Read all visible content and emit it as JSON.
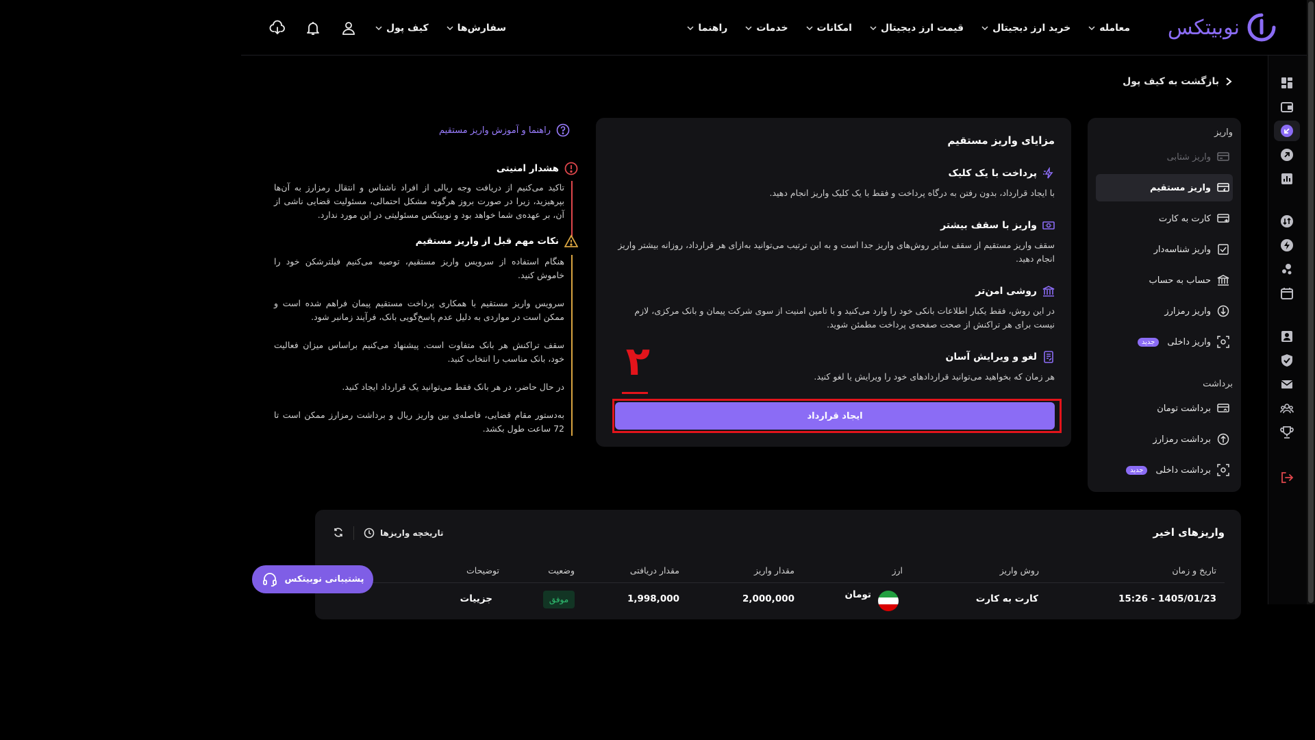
{
  "brand": {
    "name": "نوبیتکس",
    "color": "#8b6cf5"
  },
  "nav": {
    "items": [
      "معامله",
      "خرید ارز دیجیتال",
      "قیمت ارز دیجیتال",
      "امکانات",
      "خدمات",
      "راهنما"
    ],
    "wallet": "کیف پول",
    "orders": "سفارش‌ها",
    "icons": [
      "download-app-icon",
      "bell-icon",
      "user-icon"
    ]
  },
  "back": {
    "label": "بازگشت به کیف پول"
  },
  "sidemenu": {
    "deposit_section": "واریز",
    "deposit_items": [
      {
        "label": "واریز شتابی",
        "icon": "card-bank-icon",
        "disabled": true
      },
      {
        "label": "واریز مستقیم",
        "icon": "card-in-icon",
        "active": true
      },
      {
        "label": "کارت به کارت",
        "icon": "card-transfer-icon"
      },
      {
        "label": "واریز شناسه‌دار",
        "icon": "id-check-icon"
      },
      {
        "label": "حساب به حساب",
        "icon": "bank-icon"
      },
      {
        "label": "واریز رمزارز",
        "icon": "arrow-down-circle-icon"
      },
      {
        "label": "واریز داخلی",
        "icon": "scan-icon",
        "badge": "جدید"
      }
    ],
    "withdraw_section": "برداشت",
    "withdraw_items": [
      {
        "label": "برداشت تومان",
        "icon": "card-out-icon"
      },
      {
        "label": "برداشت رمزارز",
        "icon": "arrow-up-circle-icon"
      },
      {
        "label": "برداشت داخلی",
        "icon": "scan-icon",
        "badge": "جدید"
      }
    ]
  },
  "card": {
    "title": "مزایای واریز مستقیم",
    "features": [
      {
        "title": "پرداخت با یک کلیک",
        "desc": "با ایجاد قرارداد، بدون رفتن به درگاه پرداخت و فقط با یک کلیک واریز انجام دهید."
      },
      {
        "title": "واریز با سقف بیشتر",
        "desc": "سقف واریز مستقیم از سقف سایر روش‌های واریز جدا است و به این ترتیب می‌توانید به‌ازای هر قرارداد، روزانه بیشتر واریز انجام دهید."
      },
      {
        "title": "روشی امن‌تر",
        "desc": "در این روش، فقط یکبار اطلاعات بانکی خود را وارد می‌کنید و با تامین امنیت از سوی شرکت پیمان و بانک مرکزی، لازم نیست برای هر تراکنش از صحت صفحه‌ی پرداخت مطمئن شوید."
      },
      {
        "title": "لغو و ویرایش آسان",
        "desc": "هر زمان که بخواهید می‌توانید قراردادهای خود را ویرایش یا لغو کنید."
      }
    ],
    "cta": "ایجاد قرارداد",
    "annotation": "۲"
  },
  "info": {
    "guide_link": "راهنما و آموزش واریز مستقیم",
    "security_title": "هشدار امنیتی",
    "security_body": "تاکید می‌کنیم از دریافت وجه ریالی از افراد ناشناس و انتقال رمزارز به آن‌ها بپرهیزید، زیرا در صورت بروز هرگونه مشکل احتمالی، مسئولیت قضایی ناشی از آن، بر عهده‌ی شما خواهد بود و نوبیتکس مسئولیتی در این مورد ندارد.",
    "notes_title": "نکات مهم قبل از واریز مستقیم",
    "notes": [
      "هنگام استفاده از سرویس واریز مستقیم، توصیه می‌کنیم فیلترشکن خود را خاموش کنید.",
      "سرویس واریز مستقیم با همکاری پرداخت مستقیم پیمان فراهم شده است و ممکن است در مواردی به دلیل عدم پاسخ‌گویی بانک، فرآیند زمانبر شود.",
      "سقف تراکنش هر بانک متفاوت است. پیشنهاد می‌کنیم براساس میزان فعالیت خود، بانک مناسب را انتخاب کنید.",
      "در حال حاضر، در هر بانک فقط می‌توانید یک قرارداد ایجاد کنید.",
      "به‌دستور مقام قضایی، فاصله‌ی بین واریز ریال و برداشت رمزارز ممکن است تا 72 ساعت طول بکشد."
    ]
  },
  "recent": {
    "title": "واریزهای اخیر",
    "history_label": "تاریخچه واریزها",
    "columns": [
      "تاریخ و زمان",
      "روش واریز",
      "ارز",
      "مقدار واریز",
      "مقدار دریافتی",
      "وضعیت",
      "توضیحات"
    ],
    "rows": [
      {
        "datetime": "1405/01/23 - 15:26",
        "method": "کارت به کارت",
        "currency": "تومان",
        "amount": "2,000,000",
        "received": "1,998,000",
        "status": "موفق",
        "details": "جزییات"
      }
    ]
  },
  "support": {
    "label": "پشتیبانی نوبیتکس"
  },
  "colors": {
    "accent": "#8b6cf5",
    "annotation": "#e3141b",
    "success": "#2fbf71"
  }
}
